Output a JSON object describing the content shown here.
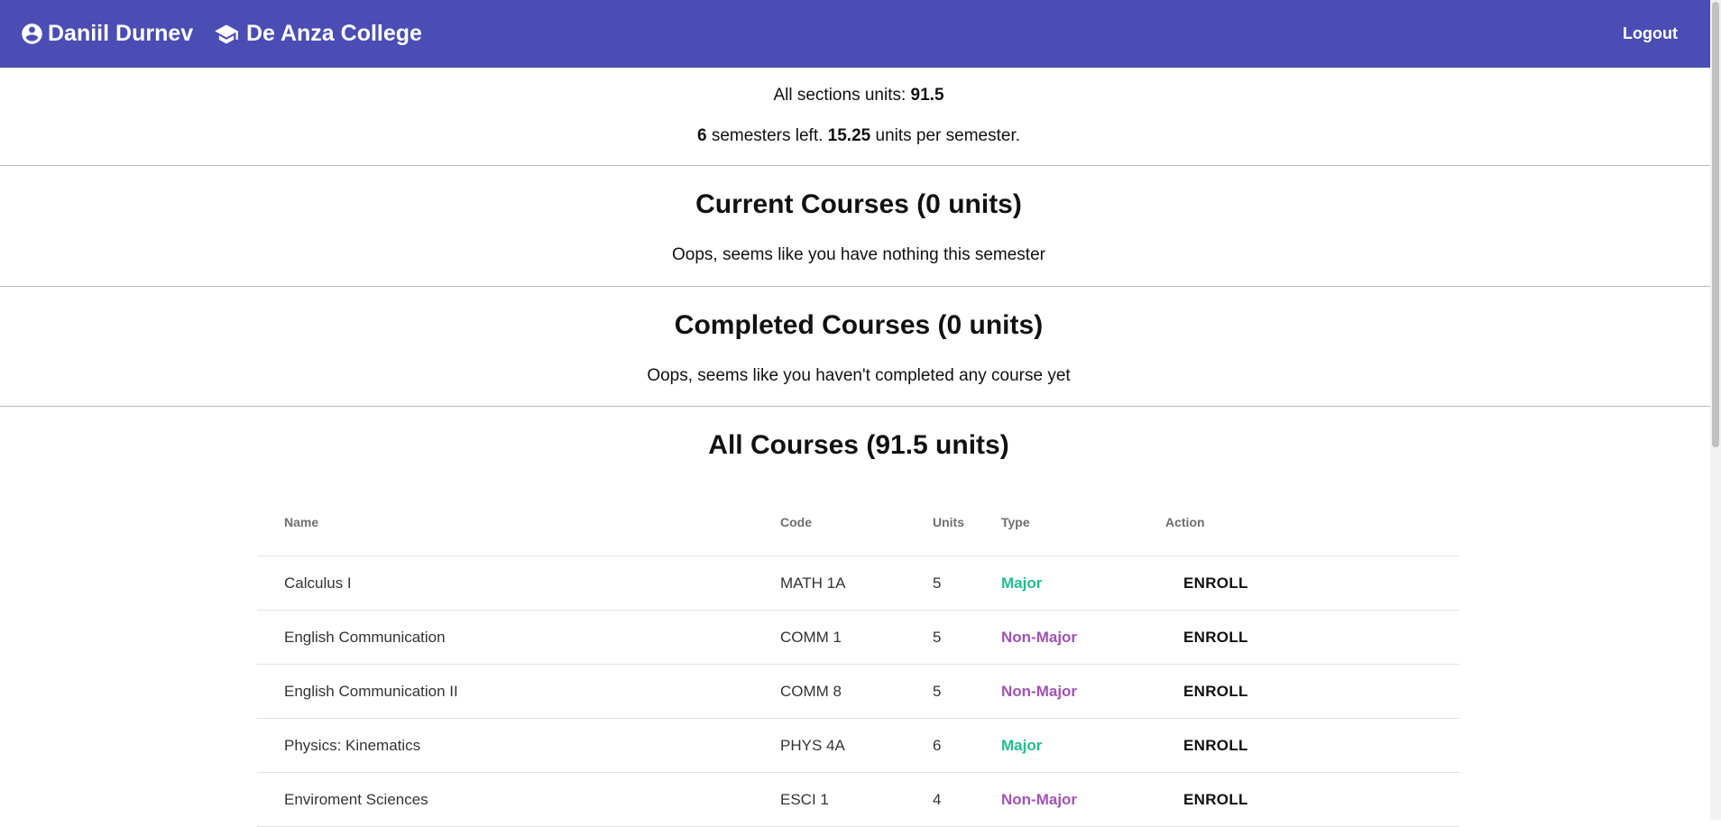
{
  "header": {
    "user_name": "Daniil Durnev",
    "college_name": "De Anza College",
    "logout_label": "Logout",
    "bg_color": "#4a4db3"
  },
  "summary": {
    "all_units_prefix": "All sections units: ",
    "all_units_value": "91.5",
    "semesters_left": "6",
    "semesters_text": " semesters left. ",
    "units_per_semester": "15.25",
    "units_per_semester_text": " units per semester."
  },
  "current": {
    "title": "Current Courses (0 units)",
    "empty_message": "Oops, seems like you have nothing this semester"
  },
  "completed": {
    "title": "Completed Courses (0 units)",
    "empty_message": "Oops, seems like you haven't completed any course yet"
  },
  "all_courses": {
    "title": "All Courses (91.5 units)",
    "columns": [
      "Name",
      "Code",
      "Units",
      "Type",
      "Action"
    ],
    "rows": [
      {
        "name": "Calculus I",
        "code": "MATH 1A",
        "units": "5",
        "type": "Major",
        "action": "ENROLL"
      },
      {
        "name": "English Communication",
        "code": "COMM 1",
        "units": "5",
        "type": "Non-Major",
        "action": "ENROLL"
      },
      {
        "name": "English Communication II",
        "code": "COMM 8",
        "units": "5",
        "type": "Non-Major",
        "action": "ENROLL"
      },
      {
        "name": "Physics: Kinematics",
        "code": "PHYS 4A",
        "units": "6",
        "type": "Major",
        "action": "ENROLL"
      },
      {
        "name": "Enviroment Sciences",
        "code": "ESCI 1",
        "units": "4",
        "type": "Non-Major",
        "action": "ENROLL"
      }
    ]
  },
  "colors": {
    "major": "#1fbf8f",
    "non_major": "#a352b6"
  }
}
